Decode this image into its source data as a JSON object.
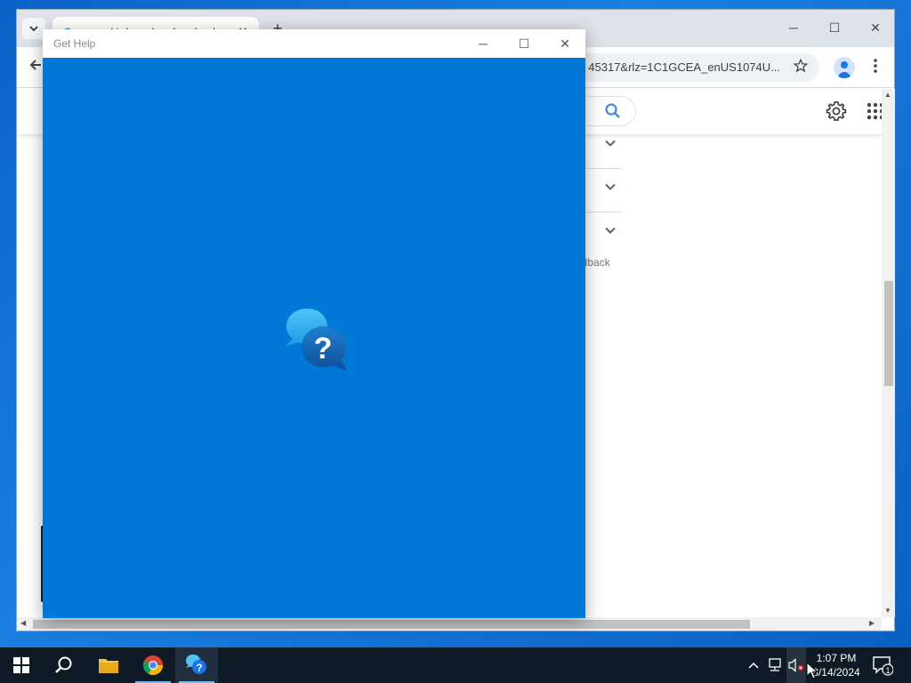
{
  "chrome": {
    "tab_title": "angry birds maker download",
    "tab_favicon": "G",
    "new_tab_symbol": "+",
    "tab_close_symbol": "✕",
    "url_fragment": "45317&rlz=1C1GCEA_enUS1074U...",
    "feedback_fragment": "edback",
    "window_controls": {
      "minimize": "─",
      "maximize": "☐",
      "close": "✕"
    }
  },
  "gethelp": {
    "title": "Get Help",
    "logo_symbol": "?",
    "controls": {
      "minimize": "─",
      "maximize": "☐",
      "close": "✕"
    },
    "background_color": "#0078d7"
  },
  "taskbar": {
    "apps": [
      "start-button",
      "search",
      "file-explorer",
      "chrome",
      "get-help"
    ],
    "clock_time": "1:07 PM",
    "clock_date": "8/14/2024",
    "notification_count": "1"
  },
  "colors": {
    "accent": "#0078d7",
    "taskbar": "#0e1a26",
    "google_blue": "#1a73e8"
  }
}
